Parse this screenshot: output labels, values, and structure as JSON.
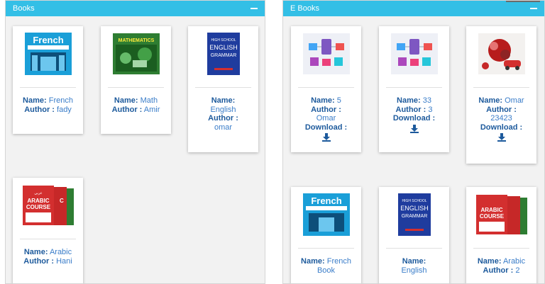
{
  "colors": {
    "header": "#33bfe6",
    "label": "#1d5a9c",
    "value": "#3a7dc9"
  },
  "books_panel": {
    "title": "Books",
    "cards": [
      {
        "image": "french-book-cover",
        "name_label": "Name:",
        "name": "French",
        "author_label": "Author :",
        "author": "fady"
      },
      {
        "image": "math-book-cover",
        "name_label": "Name:",
        "name": "Math",
        "author_label": "Author :",
        "author": "Amir"
      },
      {
        "image": "english-grammar-cover",
        "name_label": "Name:",
        "name": "English",
        "author_label": "Author :",
        "author": "omar"
      },
      {
        "image": "arabic-course-cover",
        "name_label": "Name:",
        "name": "Arabic",
        "author_label": "Author :",
        "author": "Hani"
      }
    ]
  },
  "ebooks_panel": {
    "title": "E Books",
    "cards": [
      {
        "image": "network-devices-illustration",
        "name_label": "Name:",
        "name": "5",
        "author_label": "Author :",
        "author": "Omar",
        "download_label": "Download :"
      },
      {
        "image": "network-devices-illustration",
        "name_label": "Name:",
        "name": "33",
        "author_label": "Author :",
        "author": "3",
        "download_label": "Download :"
      },
      {
        "image": "car-gift-photo",
        "name_label": "Name:",
        "name": "Omar",
        "author_label": "Author :",
        "author": "23423",
        "download_label": "Download :"
      },
      {
        "image": "french-book-cover",
        "name_label": "Name:",
        "name": "French Book"
      },
      {
        "image": "english-grammar-cover",
        "name_label": "Name:",
        "name": "English"
      },
      {
        "image": "arabic-course-cover",
        "name_label": "Name:",
        "name": "Arabic",
        "author_label": "Author :",
        "author": "2"
      }
    ]
  }
}
